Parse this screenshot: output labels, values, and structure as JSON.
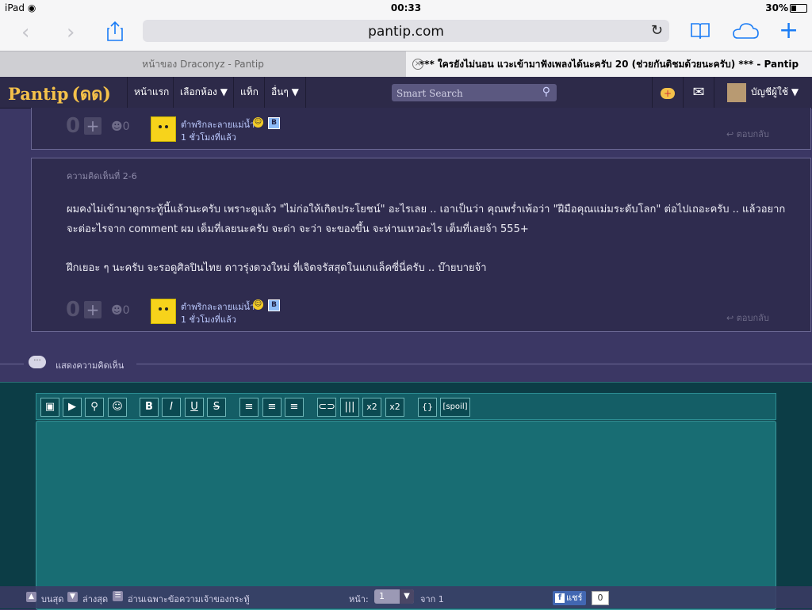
{
  "status_bar": {
    "device": "iPad",
    "wifi_icon": "wifi-icon",
    "time": "00:33",
    "battery": "30%"
  },
  "browser": {
    "url": "pantip.com",
    "tabs": [
      {
        "title": "หน้าของ Draconyz - Pantip"
      },
      {
        "title": "*** ใครยังไม่นอน แวะเข้ามาฟังเพลงได้นะครับ 20 (ช่วยกันติชมด้วยนะครับ) *** - Pantip"
      }
    ]
  },
  "nav": {
    "logo": "Pantip",
    "logo_glyph": "(ดด)",
    "items": [
      "หน้าแรก",
      "เลือกห้อง ▼",
      "แท็ก",
      "อื่นๆ ▼"
    ],
    "search_placeholder": "Smart Search",
    "account_label": "บัญชีผู้ใช้ ▼"
  },
  "comments": [
    {
      "score": "0",
      "emotion_count": "0",
      "user": "ตำพริกละลายแม่น้ำ",
      "time": "1 ชั่วโมงที่แล้ว",
      "reply_label": "ตอบกลับ"
    },
    {
      "number_label": "ความคิดเห็นที่ 2-6",
      "line1": "ผมคงไม่เข้ามาดูกระทู้นี้แล้วนะครับ เพราะดูแล้ว \"ไม่ก่อให้เกิดประโยชน์\" อะไรเลย .. เอาเป็นว่า คุณพร่ำเพ้อว่า \"ฝีมือคุณแม่มระดับโลก\" ต่อไปเถอะครับ .. แล้วอยาก",
      "line2": "จะต่อะไรจาก comment ผม เต็มที่เลยนะครับ จะด่า จะว่า จะของขึ้น จะห่านเหวอะไร เต็มที่เลยจ้า 555+",
      "line3": "ฝึกเยอะ ๆ นะครับ จะรอดูศิลปินไทย ดาวรุ่งดวงใหม่ ที่เจิดจรัสสุดในแกแล็คซี่นี่ครับ .. บ๊ายบายจ้า",
      "score": "0",
      "emotion_count": "0",
      "user": "ตำพริกละลายแม่น้ำ",
      "time": "1 ชั่วโมงที่แล้ว",
      "reply_label": "ตอบกลับ"
    }
  ],
  "section_label": "แสดงความคิดเห็น",
  "editor_buttons": [
    "camera-icon",
    "youtube-icon",
    "map-pin-icon",
    "emoji-icon",
    "B",
    "I",
    "U",
    "S",
    "align-left-icon",
    "align-center-icon",
    "align-right-icon",
    "link-icon",
    "hr-icon",
    "x2",
    "x2",
    "{}",
    "[spoil]"
  ],
  "bottom_bar": {
    "top_label": "บนสุด",
    "bottom_label": "ล่างสุด",
    "owner_only_label": "อ่านเฉพาะข้อความเจ้าของกระทู้",
    "page_label": "หน้า:",
    "page_value": "1",
    "of_label": "จาก 1",
    "share_label": "แชร์",
    "share_count": "0"
  },
  "colors": {
    "nav_bg": "#2d2a49",
    "page_bg": "#3b3764",
    "logo": "#f4c14a",
    "composer_bg": "#0c3d46",
    "safari_blue": "#1a7cf5"
  }
}
